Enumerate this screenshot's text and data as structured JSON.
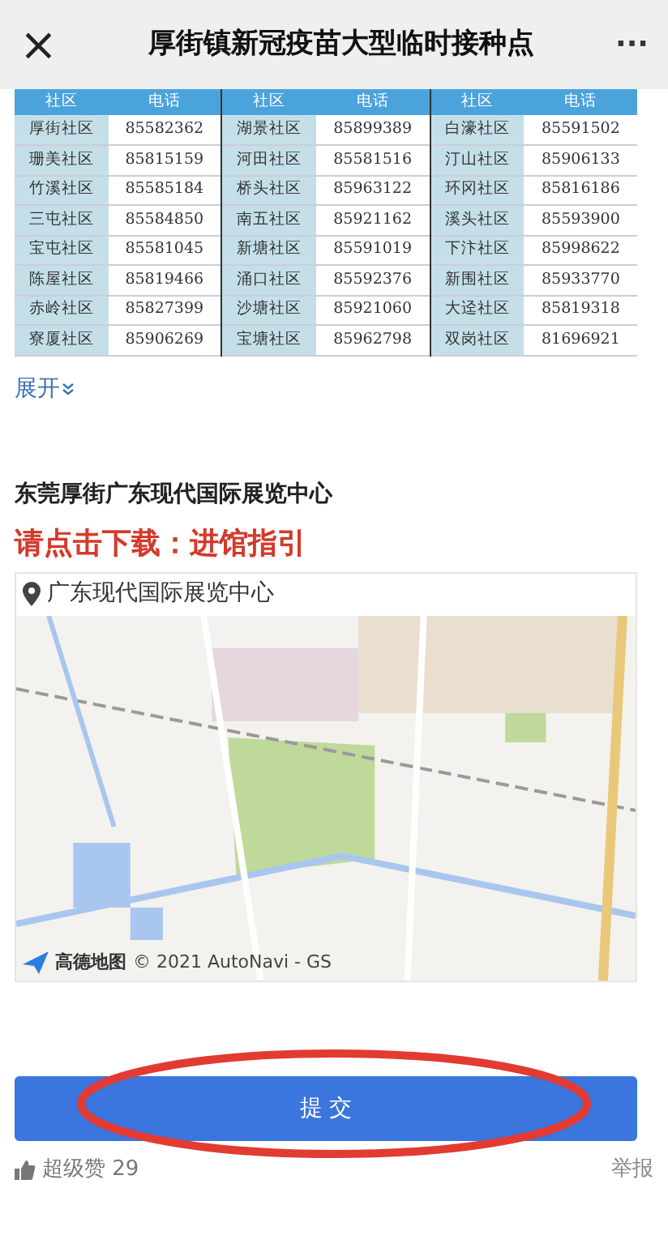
{
  "header": {
    "close": "×",
    "title": "厚街镇新冠疫苗大型临时接种点",
    "more": "···"
  },
  "table": {
    "columns": [
      "社区",
      "电话",
      "社区",
      "电话",
      "社区",
      "电话"
    ],
    "rows": [
      [
        "厚街社区",
        "85582362",
        "湖景社区",
        "85899389",
        "白濠社区",
        "85591502"
      ],
      [
        "珊美社区",
        "85815159",
        "河田社区",
        "85581516",
        "汀山社区",
        "85906133"
      ],
      [
        "竹溪社区",
        "85585184",
        "桥头社区",
        "85963122",
        "环冈社区",
        "85816186"
      ],
      [
        "三屯社区",
        "85584850",
        "南五社区",
        "85921162",
        "溪头社区",
        "85593900"
      ],
      [
        "宝屯社区",
        "85581045",
        "新塘社区",
        "85591019",
        "下汴社区",
        "85998622"
      ],
      [
        "陈屋社区",
        "85819466",
        "涌口社区",
        "85592376",
        "新围社区",
        "85933770"
      ],
      [
        "赤岭社区",
        "85827399",
        "沙塘社区",
        "85921060",
        "大迳社区",
        "85819318"
      ],
      [
        "寮厦社区",
        "85906269",
        "宝塘社区",
        "85962798",
        "双岗社区",
        "81696921"
      ]
    ]
  },
  "expand": "展开",
  "venue_title": "东莞厚街广东现代国际展览中心",
  "download_link": "请点击下载：进馆指引",
  "map": {
    "location": "广东现代国际展览中心",
    "logo": "高德地图",
    "attribution": "© 2021 AutoNavi - GS"
  },
  "submit": "提 交",
  "footer": {
    "likes": "超级赞 29",
    "report": "举报"
  }
}
